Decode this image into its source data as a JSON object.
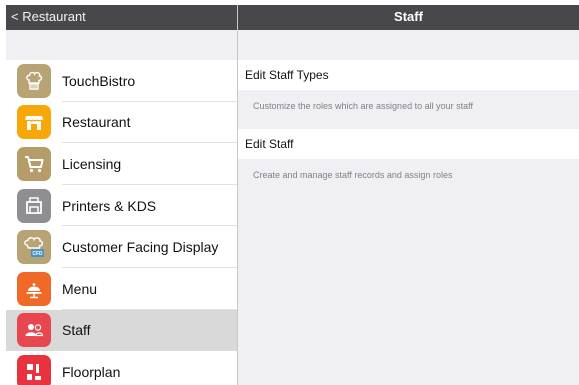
{
  "nav": {
    "back_label": "< Restaurant",
    "title": "Staff"
  },
  "sidebar": {
    "items": [
      {
        "label": "TouchBistro",
        "icon": "chef-hat-icon",
        "color": "#b8a374"
      },
      {
        "label": "Restaurant",
        "icon": "storefront-icon",
        "color": "#f7a707"
      },
      {
        "label": "Licensing",
        "icon": "cart-icon",
        "color": "#b59c68"
      },
      {
        "label": "Printers & KDS",
        "icon": "printer-icon",
        "color": "#8e8e93"
      },
      {
        "label": "Customer Facing Display",
        "icon": "cfd-display-icon",
        "color": "#b8a374"
      },
      {
        "label": "Menu",
        "icon": "food-cloche-icon",
        "color": "#f06a27"
      },
      {
        "label": "Staff",
        "icon": "staff-people-icon",
        "color": "#e8474f",
        "selected": true
      },
      {
        "label": "Floorplan",
        "icon": "floorplan-icon",
        "color": "#e8333f"
      }
    ]
  },
  "staff": {
    "edit_types_label": "Edit Staff Types",
    "edit_types_desc": "Customize the roles which are assigned to all your staff",
    "edit_staff_label": "Edit Staff",
    "edit_staff_desc": "Create and manage staff records and assign roles"
  },
  "icon_badges": {
    "cfd": "CFD"
  },
  "colors": {
    "nav_bar": "#47474c",
    "background": "#efeff4",
    "selected_row": "#d9d9d9"
  }
}
